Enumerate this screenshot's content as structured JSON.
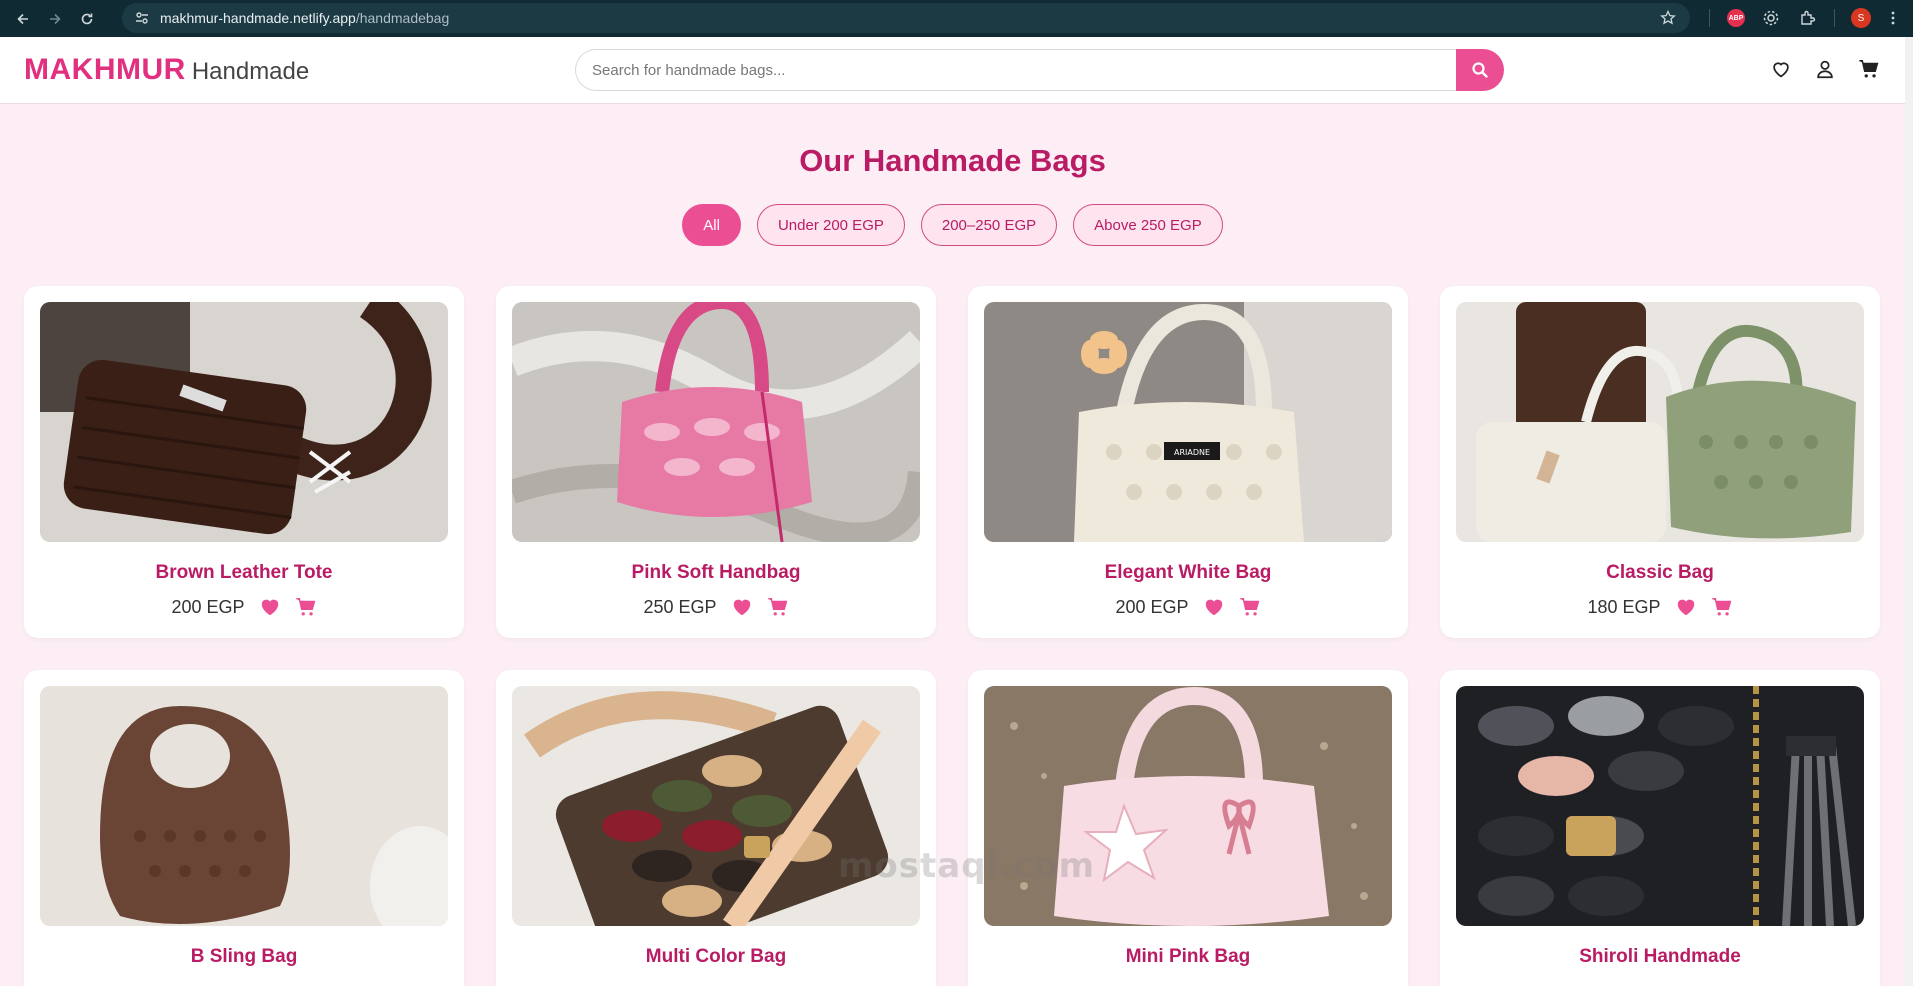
{
  "browser": {
    "url_host": "makhmur-handmade.netlify.app",
    "url_path": "/handmadebag",
    "profile_initial": "S",
    "abp_label": "ABP"
  },
  "site": {
    "logo_brand": "MAKHMUR",
    "logo_sub": "Handmade",
    "search_placeholder": "Search for handmade bags..."
  },
  "main": {
    "title": "Our Handmade Bags",
    "filters": [
      {
        "label": "All",
        "active": true
      },
      {
        "label": "Under 200 EGP",
        "active": false
      },
      {
        "label": "200–250 EGP",
        "active": false
      },
      {
        "label": "Above 250 EGP",
        "active": false
      }
    ],
    "products": [
      {
        "name": "Brown Leather Tote",
        "price": "200 EGP"
      },
      {
        "name": "Pink Soft Handbag",
        "price": "250 EGP"
      },
      {
        "name": "Elegant White Bag",
        "price": "200 EGP"
      },
      {
        "name": "Classic Bag",
        "price": "180 EGP"
      },
      {
        "name": "B Sling Bag",
        "price": ""
      },
      {
        "name": "Multi Color Bag",
        "price": ""
      },
      {
        "name": "Mini Pink Bag",
        "price": ""
      },
      {
        "name": "Shiroli Handmade",
        "price": ""
      }
    ]
  },
  "watermark": "mostaql.com",
  "colors": {
    "accent": "#ec4e94",
    "title": "#b91c64",
    "background": "#fdeef6"
  }
}
